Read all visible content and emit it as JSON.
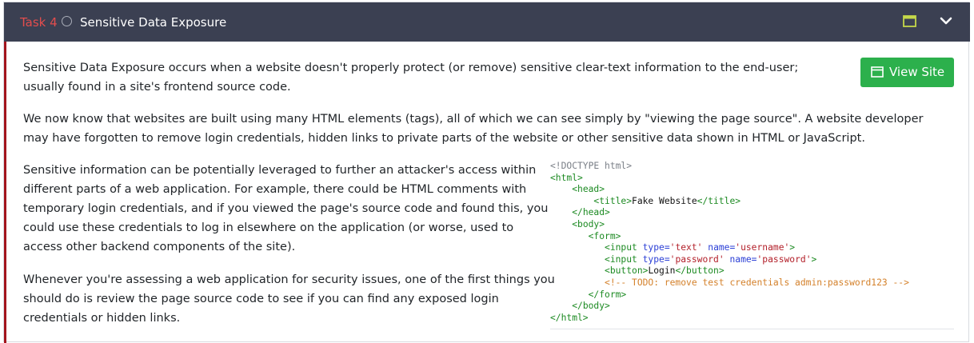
{
  "task": {
    "number_label": "Task 4",
    "title": "Sensitive Data Exposure"
  },
  "header_icons": {
    "split": "split-view-icon",
    "toggle": "chevron-down-icon"
  },
  "view_site_button": {
    "label": "View Site",
    "icon": "window-icon"
  },
  "paragraphs": [
    "Sensitive Data Exposure occurs when a website doesn't properly protect (or remove) sensitive clear-text information to the end-user; usually found in a site's frontend source code.",
    "We now know that websites are built using many HTML elements (tags), all of which we can see simply by \"viewing the page source\". A website developer may have forgotten to remove login credentials, hidden links to private parts of the website or other sensitive data shown in HTML or JavaScript.",
    "Sensitive information can be potentially leveraged to further an attacker's access within different parts of a web application. For example, there could be HTML comments with temporary login credentials, and if you viewed the page's source code and found this, you could use these credentials to log in elsewhere on the application (or worse, used to access other backend components of the site).",
    "Whenever you're assessing a web application for security issues, one of the first things you should do is review the page source code to see if you can find any exposed login credentials or hidden links."
  ],
  "code": {
    "doctype": "<!DOCTYPE html>",
    "html_open": "<html>",
    "head_open": "<head>",
    "title_open": "<title>",
    "title_text": "Fake Website",
    "title_close": "</title>",
    "head_close": "</head>",
    "body_open": "<body>",
    "form_open": "<form>",
    "input_open": "<input ",
    "type_attr": "type=",
    "type_text_val": "'text'",
    "name_attr": "name=",
    "username_val": "'username'",
    "tag_end": ">",
    "type_pw_val": "'password'",
    "password_val": "'password'",
    "button_open": "<button>",
    "button_text": "Login",
    "button_close": "</button>",
    "comment": "<!-- TODO: remove test credentials admin:password123 -->",
    "form_close": "</form>",
    "body_close": "</body>",
    "html_close": "</html>"
  },
  "colors": {
    "header_bg": "#3b4052",
    "task_number": "#e34d4d",
    "accent_border": "#a3151d",
    "button_bg": "#2cb04c"
  }
}
